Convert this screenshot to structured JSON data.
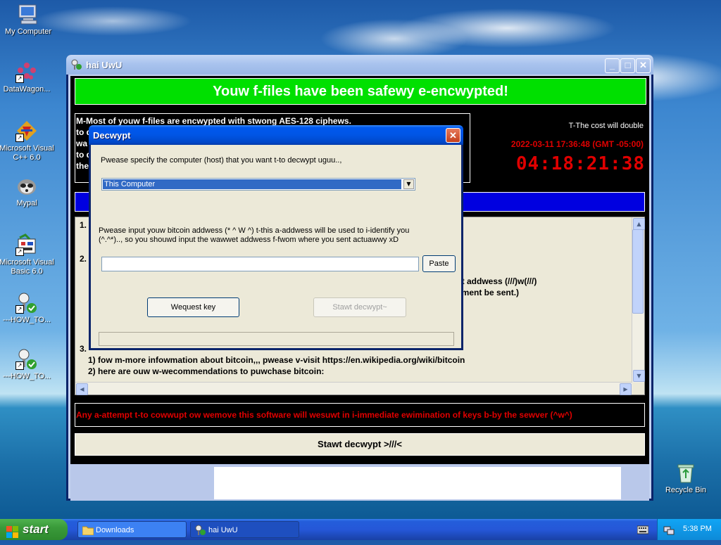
{
  "desktop": {
    "icons": [
      {
        "label": "My Computer"
      },
      {
        "label": "DataWagon..."
      },
      {
        "label": "Microsoft Visual C++ 6.0"
      },
      {
        "label": "Mypal"
      },
      {
        "label": "Microsoft Visual Basic 6.0"
      },
      {
        "label": "---HOW_TO..."
      },
      {
        "label": "---HOW_TO..."
      },
      {
        "label": "Recycle Bin"
      }
    ]
  },
  "main_window": {
    "title": "hai UwU",
    "header": "Youw f-files have been safewy e-encwypted!",
    "info_lines": [
      "M-Most of youw f-files are encwypted with stwong AES-128 ciphews.",
      "to d",
      "wa",
      "to d",
      "the"
    ],
    "cost_note": "T-The cost will double",
    "deadline": "2022-03-11 17:36:48 (GMT -05:00)",
    "timer": "04:18:21:38",
    "panel": {
      "step1": "1.",
      "step2": "2.",
      "line_fragment_a": "et addwess (///)w(///)",
      "line_fragment_b": "yment be sent.)",
      "step3": "3.",
      "line1": "1) fow m-more infowmation about bitcoin,,, pwease v-visit https://en.wikipedia.org/wiki/bitcoin",
      "line2": "2) here are ouw w-wecommendations to puwchase bitcoin:"
    },
    "warning": "Any a-attempt t-to cowwupt ow wemove this software will wesuwt in i-immediate ewimination of keys b-by the sewver (^w^)",
    "start_button": "Stawt decwypt >///<"
  },
  "dialog": {
    "title": "Decwypt",
    "host_prompt": "Pwease specify the computer (host) that you want t-to decwypt uguu..,",
    "host_selected": "This Computer",
    "address_prompt_1": "Pwease input youw bitcoin addwess (* ^ W ^) t-this a-addwess will be used to i-identify you",
    "address_prompt_2": "(^.^*).., so you shouwd input the wawwet addwess f-fwom where you sent actuawwy xD",
    "address_value": "",
    "paste_label": "Paste",
    "request_key_label": "Wequest key",
    "start_decrypt_label": "Stawt decwypt~"
  },
  "taskbar": {
    "start_label": "start",
    "tasks": [
      {
        "label": "Downloads"
      },
      {
        "label": "hai UwU"
      }
    ],
    "clock": "5:38 PM"
  }
}
